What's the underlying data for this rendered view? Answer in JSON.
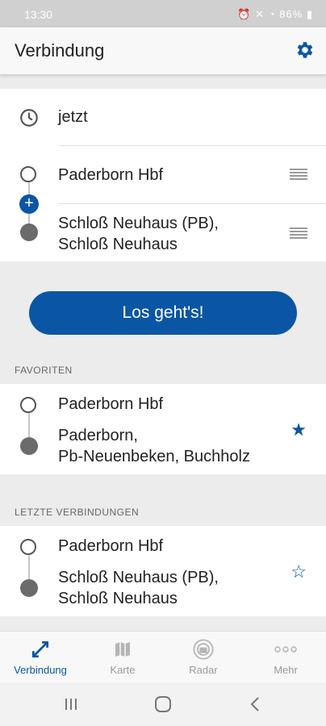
{
  "status": {
    "time": "13:30",
    "battery": "86%"
  },
  "header": {
    "title": "Verbindung"
  },
  "trip": {
    "time_value": "jetzt",
    "from": "Paderborn Hbf",
    "to_line1": "Schloß Neuhaus (PB),",
    "to_line2": "Schloß Neuhaus"
  },
  "search_button": "Los geht's!",
  "favorites": {
    "label": "FAVORITEN",
    "items": [
      {
        "from": "Paderborn Hbf",
        "to_line1": "Paderborn,",
        "to_line2": "Pb-Neuenbeken, Buchholz",
        "starred": true
      }
    ]
  },
  "recent": {
    "label": "LETZTE VERBINDUNGEN",
    "items": [
      {
        "from": "Paderborn Hbf",
        "to_line1": "Schloß Neuhaus (PB),",
        "to_line2": "Schloß Neuhaus",
        "starred": false
      }
    ]
  },
  "nav": [
    {
      "label": "Verbindung",
      "active": true
    },
    {
      "label": "Karte",
      "active": false
    },
    {
      "label": "Radar",
      "active": false
    },
    {
      "label": "Mehr",
      "active": false
    }
  ],
  "colors": {
    "accent": "#0a56a5",
    "stop_fill": "#6b6b6b"
  }
}
